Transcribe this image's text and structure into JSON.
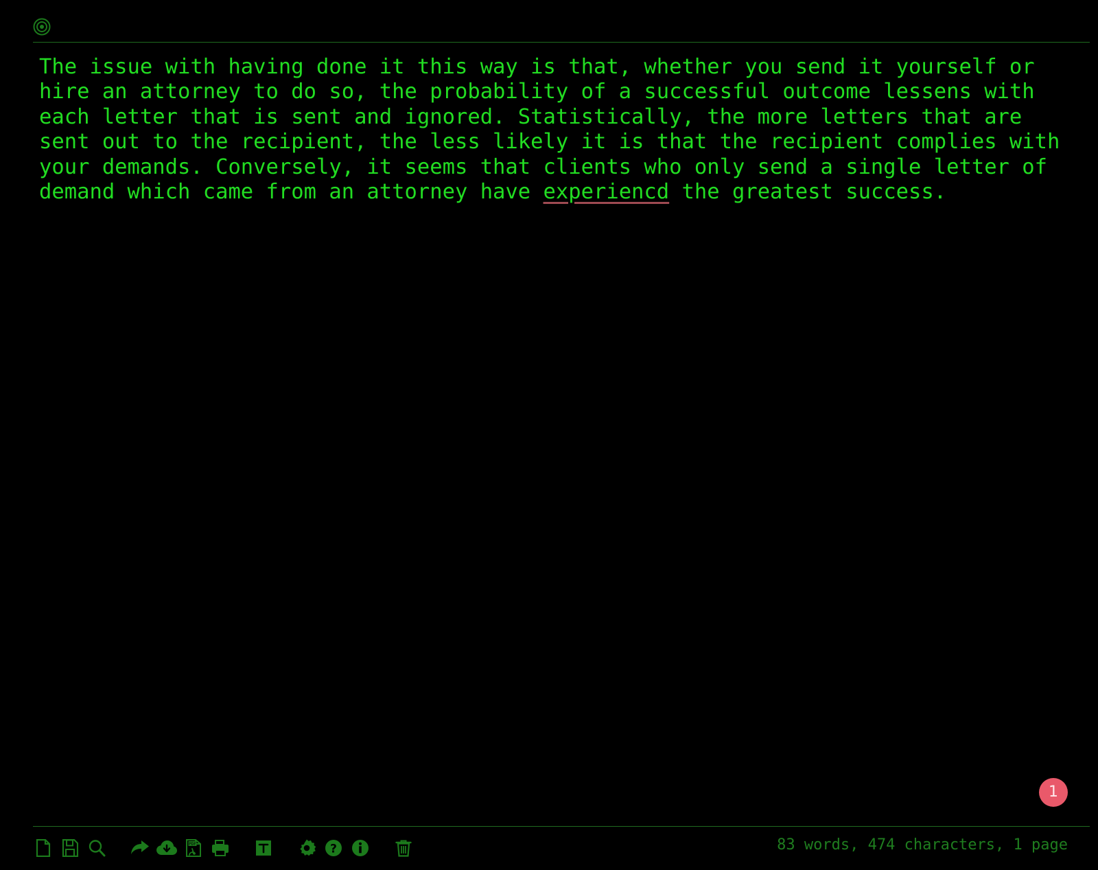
{
  "app": {
    "background_color": "#000000",
    "text_color": "#22dd22",
    "accent_color": "#1c7a1c",
    "badge_color": "#e9596a",
    "spellcheck_underline_color": "#9e4a52"
  },
  "topbar": {
    "record_icon": "target-bullseye-icon"
  },
  "document": {
    "text_before_misspelling": "The issue with having done it this way is that, whether you send it yourself or hire an attorney to do so, the probability of a successful outcome lessens with each letter that is sent and ignored. Statistically, the more letters that are sent out to the recipient, the less likely it is that the recipient complies with your demands. Conversely, it seems that clients who only send a single letter of demand which came from an attorney have ",
    "misspelled_word": "experiencd",
    "text_after_misspelling": " the greatest success.",
    "full_text": "The issue with having done it this way is that, whether you send it yourself or hire an attorney to do so, the probability of a successful outcome lessens with each letter that is sent and ignored. Statistically, the more letters that are sent out to the recipient, the less likely it is that the recipient complies with your demands. Conversely, it seems that clients who only send a single letter of demand which came from an attorney have experiencd the greatest success."
  },
  "page_badge": {
    "count": "1"
  },
  "toolbar": {
    "items": [
      {
        "name": "new-document-icon",
        "label": "New"
      },
      {
        "name": "save-icon",
        "label": "Save"
      },
      {
        "name": "search-icon",
        "label": "Search"
      },
      {
        "name": "share-icon",
        "label": "Share"
      },
      {
        "name": "cloud-download-icon",
        "label": "Download"
      },
      {
        "name": "pdf-export-icon",
        "label": "Export PDF"
      },
      {
        "name": "print-icon",
        "label": "Print"
      },
      {
        "name": "text-format-icon",
        "label": "Text"
      },
      {
        "name": "settings-gear-icon",
        "label": "Settings"
      },
      {
        "name": "help-icon",
        "label": "Help"
      },
      {
        "name": "info-icon",
        "label": "Info"
      },
      {
        "name": "trash-icon",
        "label": "Delete"
      }
    ]
  },
  "statusbar": {
    "text": "83 words, 474 characters, 1 page",
    "words": "83",
    "characters": "474",
    "pages": "1"
  }
}
